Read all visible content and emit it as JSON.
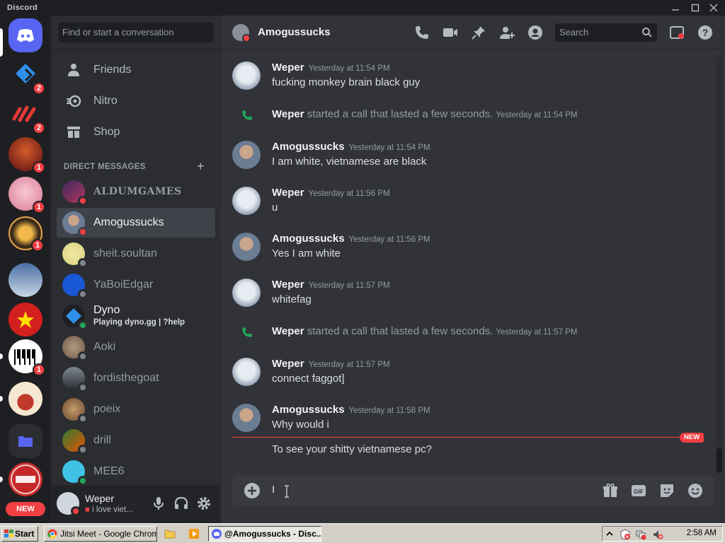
{
  "window": {
    "app_name": "Discord"
  },
  "sidebar": {
    "search_placeholder": "Find or start a conversation",
    "nav": [
      {
        "label": "Friends",
        "icon": "friends-icon"
      },
      {
        "label": "Nitro",
        "icon": "nitro-icon"
      },
      {
        "label": "Shop",
        "icon": "shop-icon"
      }
    ],
    "dm_header": "DIRECT MESSAGES",
    "dms": [
      {
        "name": "ALDUMGAMES",
        "status": "dnd"
      },
      {
        "name": "Amogussucks",
        "status": "dnd",
        "active": true
      },
      {
        "name": "sheit.soultan",
        "status": "offline"
      },
      {
        "name": "YaBoiEdgar",
        "status": "offline"
      },
      {
        "name": "Dyno",
        "status": "online",
        "activity": "Playing dyno.gg | ?help"
      },
      {
        "name": "Aoki",
        "status": "offline"
      },
      {
        "name": "fordisthegoat",
        "status": "offline"
      },
      {
        "name": "poeix",
        "status": "offline"
      },
      {
        "name": "drill",
        "status": "offline"
      },
      {
        "name": "MEE6",
        "status": "online"
      }
    ]
  },
  "servers": [
    {
      "badge": ""
    },
    {
      "badge": "2"
    },
    {
      "badge": "2"
    },
    {
      "badge": "1"
    },
    {
      "badge": "1"
    },
    {
      "badge": "1"
    },
    {
      "badge": ""
    },
    {
      "badge": ""
    },
    {
      "badge": "1"
    },
    {
      "badge": ""
    },
    {
      "badge": ""
    },
    {
      "badge": ""
    }
  ],
  "servers_new_label": "NEW",
  "user_panel": {
    "username": "Weper",
    "status_text": "i love viet..."
  },
  "chat": {
    "title": "Amogussucks",
    "search_placeholder": "Search",
    "messages": [
      {
        "type": "msg",
        "author": "Weper",
        "time": "Yesterday at 11:54 PM",
        "text": "fucking monkey brain black guy"
      },
      {
        "type": "call",
        "author": "Weper",
        "text": "started a call that lasted a few seconds.",
        "time": "Yesterday at 11:54 PM"
      },
      {
        "type": "msg",
        "author": "Amogussucks",
        "time": "Yesterday at 11:54 PM",
        "text": "I am white, vietnamese are black"
      },
      {
        "type": "msg",
        "author": "Weper",
        "time": "Yesterday at 11:56 PM",
        "text": "u"
      },
      {
        "type": "msg",
        "author": "Amogussucks",
        "time": "Yesterday at 11:56 PM",
        "text": "Yes I am white"
      },
      {
        "type": "msg",
        "author": "Weper",
        "time": "Yesterday at 11:57 PM",
        "text": "whitefag"
      },
      {
        "type": "call",
        "author": "Weper",
        "text": "started a call that lasted a few seconds.",
        "time": "Yesterday at 11:57 PM"
      },
      {
        "type": "msg",
        "author": "Weper",
        "time": "Yesterday at 11:57 PM",
        "text": "connect faggot]"
      },
      {
        "type": "msg",
        "author": "Amogussucks",
        "time": "Yesterday at 11:58 PM",
        "text": "Why would i"
      }
    ],
    "new_label": "NEW",
    "after_new_text": "To see your shitty vietnamese pc?",
    "composer_value": "I"
  },
  "taskbar": {
    "start": "Start",
    "buttons": [
      {
        "label": "Jitsi Meet - Google Chrome"
      },
      {
        "label": "@Amogussucks - Disc..."
      }
    ],
    "clock": "2:58 AM"
  },
  "colors": {
    "dnd": "#f23f43",
    "online": "#23a55a",
    "offline": "#80848e",
    "accent": "#5865f2"
  }
}
